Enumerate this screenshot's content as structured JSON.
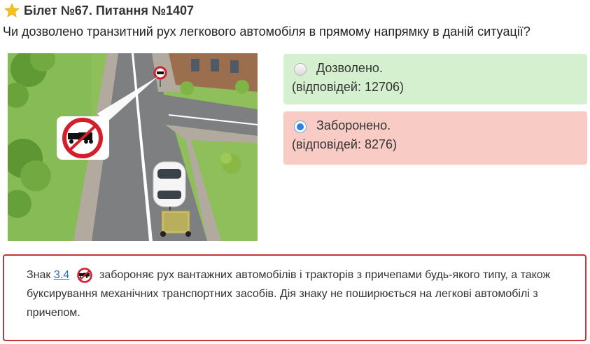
{
  "header": {
    "star_icon": "star-icon",
    "title": "Білет №67. Питання №1407"
  },
  "question": "Чи дозволено транзитний рух легкового автомобіля в прямому напрямку в даній ситуації?",
  "answers": [
    {
      "label": "Дозволено.",
      "responses": "(відповідей: 12706)",
      "selected": false,
      "status_color": "#d5f0cf"
    },
    {
      "label": "Заборонено.",
      "responses": "(відповідей: 8276)",
      "selected": true,
      "status_color": "#f8cbc4"
    }
  ],
  "explanation": {
    "prefix": "Знак",
    "link": "3.4",
    "sign_icon": "no-trucks-with-trailer-sign-icon",
    "text": "забороняє рух вантажних автомобілів і тракторів з причепами будь-якого типу, а також буксирування механічних транспортних засобів. Дія знаку не поширюється на легкові автомобілі з причепом."
  },
  "colors": {
    "correct_bg": "#d5f0cf",
    "wrong_bg": "#f8cbc4",
    "explain_border": "#c2353b",
    "link": "#2a6fc9"
  }
}
